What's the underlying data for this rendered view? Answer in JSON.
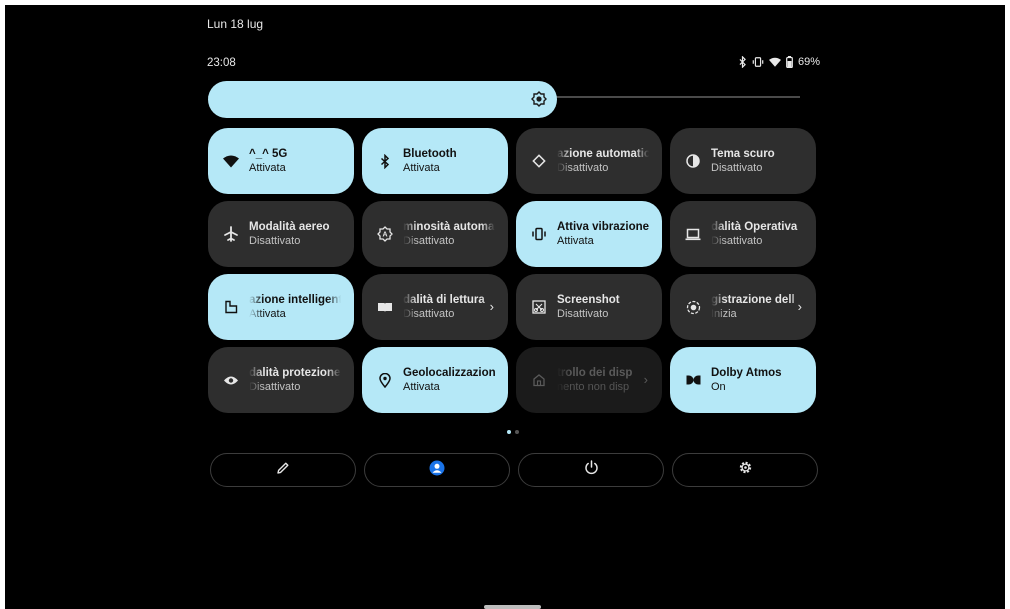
{
  "header": {
    "date": "Lun 18 lug",
    "time": "23:08",
    "battery": "69%"
  },
  "brightness": {
    "level_percent": 59
  },
  "tiles": [
    {
      "title": "^_^ 5G",
      "subtitle": "Attivata",
      "icon": "wifi-icon",
      "state": "on"
    },
    {
      "title": "Bluetooth",
      "subtitle": "Attivata",
      "icon": "bluetooth-icon",
      "state": "on"
    },
    {
      "title": "azione automatica",
      "subtitle": "Disattivato",
      "icon": "auto-rotate-icon",
      "state": "off"
    },
    {
      "title": "Tema scuro",
      "subtitle": "Disattivato",
      "icon": "dark-theme-icon",
      "state": "off"
    },
    {
      "title": "Modalità aereo",
      "subtitle": "Disattivato",
      "icon": "airplane-icon",
      "state": "off"
    },
    {
      "title": "minosità automatic",
      "subtitle": "Disattivato",
      "icon": "auto-brightness-icon",
      "state": "off"
    },
    {
      "title": "Attiva vibrazione",
      "subtitle": "Attivata",
      "icon": "vibrate-icon",
      "state": "on"
    },
    {
      "title": "dalità Operativa",
      "subtitle": "Disattivato",
      "icon": "laptop-icon",
      "state": "off"
    },
    {
      "title": "azione intelligente",
      "subtitle": "Attivata",
      "icon": "smart-rotate-icon",
      "state": "on"
    },
    {
      "title": "dalità di lettura",
      "subtitle": "Disattivato",
      "icon": "reading-mode-icon",
      "state": "off"
    },
    {
      "title": "Screenshot",
      "subtitle": "Disattivato",
      "icon": "screenshot-icon",
      "state": "off"
    },
    {
      "title": "gistrazione dell",
      "subtitle": "Inizia",
      "icon": "screen-record-icon",
      "state": "off"
    },
    {
      "title": "dalità protezione o",
      "subtitle": "Disattivato",
      "icon": "eye-icon",
      "state": "off"
    },
    {
      "title": "Geolocalizzazione",
      "subtitle": "Attivata",
      "icon": "location-icon",
      "state": "on"
    },
    {
      "title": "trollo dei disp",
      "subtitle": "nento non disp",
      "icon": "home-icon",
      "state": "dim"
    },
    {
      "title": "Dolby Atmos",
      "subtitle": "On",
      "icon": "dolby-icon",
      "state": "on"
    }
  ],
  "bottom": {
    "edit": "pencil-icon",
    "user": "user-icon",
    "power": "power-icon",
    "settings": "gear-icon"
  },
  "colors": {
    "active": "#b5e8f7",
    "inactive": "#2e2e2e",
    "accent": "#1a73e8"
  }
}
